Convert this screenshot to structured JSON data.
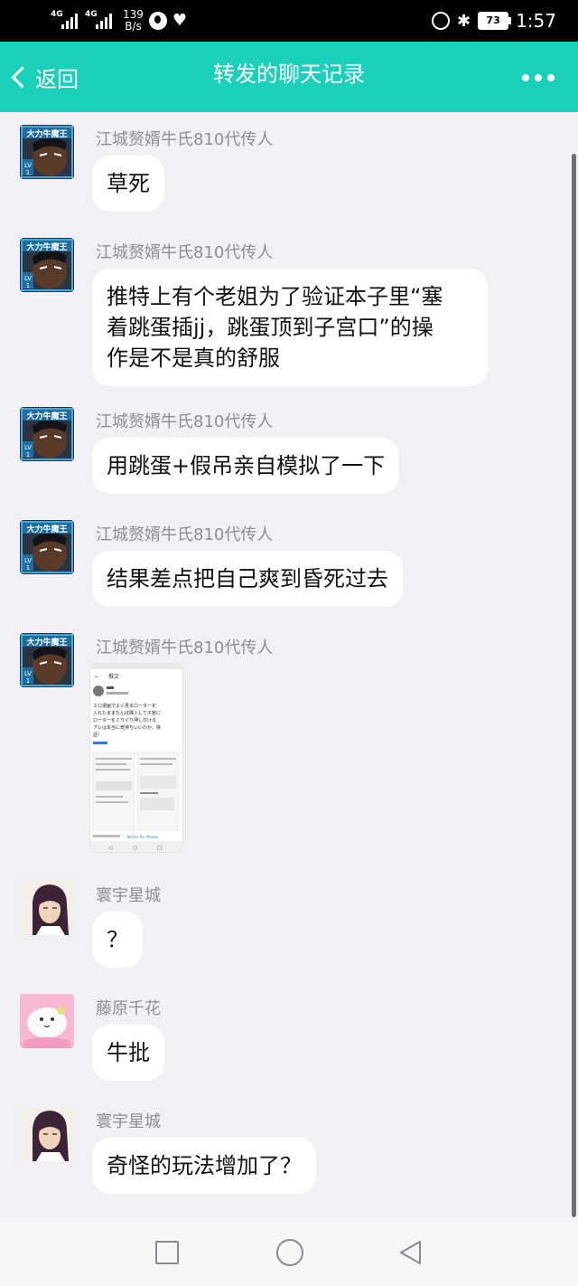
{
  "status_bar": {
    "net1": "4G",
    "net2": "4G",
    "speed_value": "139",
    "speed_unit": "B/s",
    "battery": "73",
    "time": "1:57"
  },
  "header": {
    "back_label": "返回",
    "title": "转发的聊天记录"
  },
  "colors": {
    "header_bg": "#1ad0ba",
    "chat_bg": "#f1f1f5",
    "bubble_bg": "#ffffff"
  },
  "messages": [
    {
      "sender": "江城赘婿牛氏810代传人",
      "avatar": "bull-demon-king-avatar",
      "text": "草死"
    },
    {
      "sender": "江城赘婿牛氏810代传人",
      "avatar": "bull-demon-king-avatar",
      "lines": [
        "推特上有个老姐为了验证本子里“塞",
        "着跳蛋插jj，跳蛋顶到子宫口”的操",
        "作是不是真的舒服"
      ]
    },
    {
      "sender": "江城赘婿牛氏810代传人",
      "avatar": "bull-demon-king-avatar",
      "text": "用跳蛋+假吊亲自模拟了一下"
    },
    {
      "sender": "江城赘婿牛氏810代传人",
      "avatar": "bull-demon-king-avatar",
      "text": "结果差点把自己爽到昏死过去"
    },
    {
      "sender": "江城赘婿牛氏810代传人",
      "avatar": "bull-demon-king-avatar",
      "image": {
        "header": "推文",
        "tweet_lines": [
          "エロ漫画でよく見るローターを",
          "入れたままちんぽ挿入して子宮に",
          "ローターをぐりぐり押し付ける",
          "アレは本当に気持ちいいのか、検",
          "証!"
        ],
        "footer": "Twitter for iPhone"
      }
    },
    {
      "sender": "寰宇星城",
      "avatar": "long-hair-man-avatar",
      "text": "？"
    },
    {
      "sender": "藤原千花",
      "avatar": "pink-mascot-avatar",
      "text": "牛批"
    },
    {
      "sender": "寰宇星城",
      "avatar": "long-hair-man-avatar",
      "text": "奇怪的玩法增加了？"
    }
  ]
}
